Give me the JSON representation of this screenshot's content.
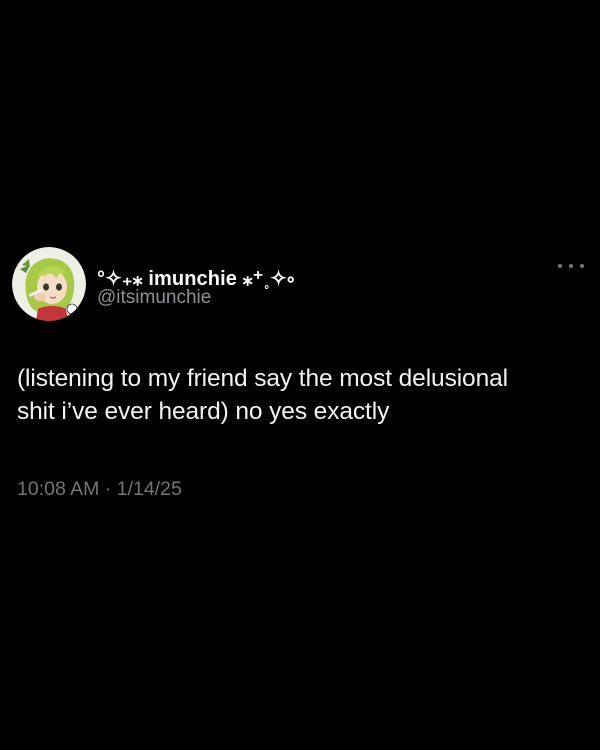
{
  "tweet": {
    "display_name": "°✧₊⁎ imunchie ⁎⁺˳✧༚",
    "handle": "@itsimunchie",
    "text_lines": [
      "(listening to my friend say the most delusional",
      "shit i’ve ever heard) no yes exactly"
    ],
    "time": "10:08 AM",
    "separator": "·",
    "date": "1/14/25",
    "more_icon": "more-horizontal-icon",
    "avatar": "avatar"
  },
  "colors": {
    "background": "#000000",
    "primary_text": "#e7e9ea",
    "secondary_text": "#71767b"
  }
}
